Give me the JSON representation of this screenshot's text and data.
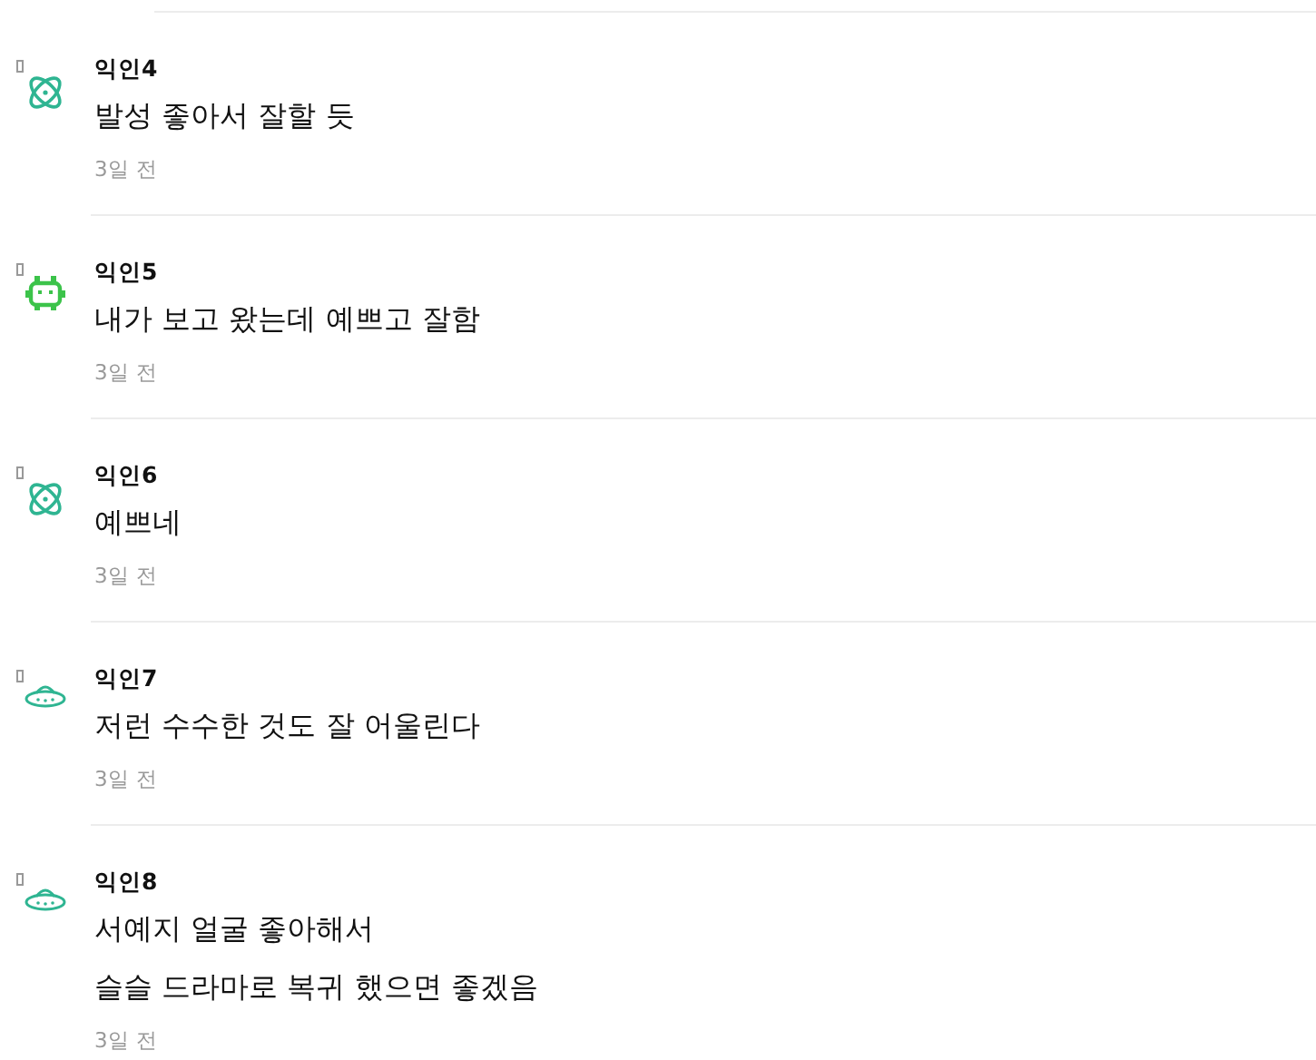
{
  "comments": [
    {
      "author": "익인4",
      "kind": "atom",
      "lines": [
        "발성 좋아서 잘할 듯"
      ],
      "time": "3일 전"
    },
    {
      "author": "익인5",
      "kind": "robot",
      "lines": [
        "내가 보고 왔는데 예쁘고 잘함"
      ],
      "time": "3일 전"
    },
    {
      "author": "익인6",
      "kind": "atom",
      "lines": [
        "예쁘네"
      ],
      "time": "3일 전"
    },
    {
      "author": "익인7",
      "kind": "ufo",
      "lines": [
        "저런 수수한 것도 잘 어울린다"
      ],
      "time": "3일 전"
    },
    {
      "author": "익인8",
      "kind": "ufo",
      "lines": [
        "서예지 얼굴 좋아해서",
        "슬슬 드라마로 복귀 했으면 좋겠음"
      ],
      "time": "3일 전"
    }
  ]
}
